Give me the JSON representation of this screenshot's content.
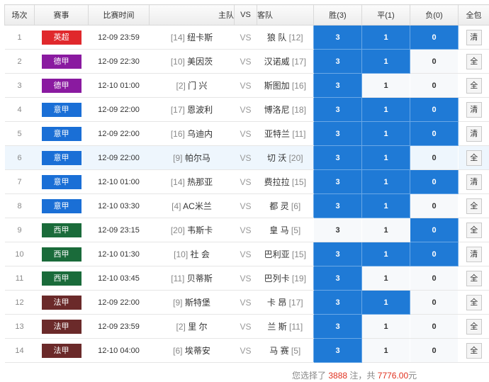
{
  "headers": {
    "idx": "场次",
    "league": "赛事",
    "time": "比赛时间",
    "home": "主队",
    "vs": "VS",
    "away": "客队",
    "win": "胜(3)",
    "draw": "平(1)",
    "lose": "负(0)",
    "all": "全包"
  },
  "odds_labels": {
    "win": "3",
    "draw": "1",
    "lose": "0"
  },
  "league_colors": {
    "英超": "#e0282c",
    "德甲": "#8a1aa0",
    "意甲": "#1a6fd6",
    "西甲": "#1a6b3a",
    "法甲": "#6b2a2a"
  },
  "selected_color": "#1f7ad6",
  "rows": [
    {
      "idx": "1",
      "league": "英超",
      "time": "12-09 23:59",
      "home_rank": "[14]",
      "home": "纽卡斯",
      "vs": "VS",
      "away": "狼 队",
      "away_rank": "[12]",
      "sel": [
        true,
        true,
        true
      ],
      "btn": "清"
    },
    {
      "idx": "2",
      "league": "德甲",
      "time": "12-09 22:30",
      "home_rank": "[10]",
      "home": "美因茨",
      "vs": "VS",
      "away": "汉诺威",
      "away_rank": "[17]",
      "sel": [
        true,
        true,
        false
      ],
      "btn": "全"
    },
    {
      "idx": "3",
      "league": "德甲",
      "time": "12-10 01:00",
      "home_rank": "[2]",
      "home": "门 兴",
      "vs": "VS",
      "away": "斯图加",
      "away_rank": "[16]",
      "sel": [
        true,
        false,
        false
      ],
      "btn": "全"
    },
    {
      "idx": "4",
      "league": "意甲",
      "time": "12-09 22:00",
      "home_rank": "[17]",
      "home": "恩波利",
      "vs": "VS",
      "away": "博洛尼",
      "away_rank": "[18]",
      "sel": [
        true,
        true,
        true
      ],
      "btn": "清"
    },
    {
      "idx": "5",
      "league": "意甲",
      "time": "12-09 22:00",
      "home_rank": "[16]",
      "home": "乌迪内",
      "vs": "VS",
      "away": "亚特兰",
      "away_rank": "[11]",
      "sel": [
        true,
        true,
        true
      ],
      "btn": "清"
    },
    {
      "idx": "6",
      "league": "意甲",
      "time": "12-09 22:00",
      "home_rank": "[9]",
      "home": "帕尔马",
      "vs": "VS",
      "away": "切 沃",
      "away_rank": "[20]",
      "sel": [
        true,
        true,
        false
      ],
      "btn": "全",
      "hl": true
    },
    {
      "idx": "7",
      "league": "意甲",
      "time": "12-10 01:00",
      "home_rank": "[14]",
      "home": "热那亚",
      "vs": "VS",
      "away": "费拉拉",
      "away_rank": "[15]",
      "sel": [
        true,
        true,
        true
      ],
      "btn": "清"
    },
    {
      "idx": "8",
      "league": "意甲",
      "time": "12-10 03:30",
      "home_rank": "[4]",
      "home": "AC米兰",
      "vs": "VS",
      "away": "都 灵",
      "away_rank": "[6]",
      "sel": [
        true,
        true,
        false
      ],
      "btn": "全"
    },
    {
      "idx": "9",
      "league": "西甲",
      "time": "12-09 23:15",
      "home_rank": "[20]",
      "home": "韦斯卡",
      "vs": "VS",
      "away": "皇 马",
      "away_rank": "[5]",
      "sel": [
        false,
        false,
        true
      ],
      "btn": "全"
    },
    {
      "idx": "10",
      "league": "西甲",
      "time": "12-10 01:30",
      "home_rank": "[10]",
      "home": "社 会",
      "vs": "VS",
      "away": "巴利亚",
      "away_rank": "[15]",
      "sel": [
        true,
        true,
        true
      ],
      "btn": "清"
    },
    {
      "idx": "11",
      "league": "西甲",
      "time": "12-10 03:45",
      "home_rank": "[11]",
      "home": "贝蒂斯",
      "vs": "VS",
      "away": "巴列卡",
      "away_rank": "[19]",
      "sel": [
        true,
        false,
        false
      ],
      "btn": "全"
    },
    {
      "idx": "12",
      "league": "法甲",
      "time": "12-09 22:00",
      "home_rank": "[9]",
      "home": "斯特堡",
      "vs": "VS",
      "away": "卡 昂",
      "away_rank": "[17]",
      "sel": [
        true,
        true,
        false
      ],
      "btn": "全"
    },
    {
      "idx": "13",
      "league": "法甲",
      "time": "12-09 23:59",
      "home_rank": "[2]",
      "home": "里 尔",
      "vs": "VS",
      "away": "兰 斯",
      "away_rank": "[11]",
      "sel": [
        true,
        false,
        false
      ],
      "btn": "全"
    },
    {
      "idx": "14",
      "league": "法甲",
      "time": "12-10 04:00",
      "home_rank": "[6]",
      "home": "埃蒂安",
      "vs": "VS",
      "away": "马 赛",
      "away_rank": "[5]",
      "sel": [
        true,
        false,
        false
      ],
      "btn": "全"
    }
  ],
  "summary": {
    "prefix": "您选择了",
    "count": "3888",
    "mid": "注，共",
    "amount": "7776.00",
    "suffix": "元"
  }
}
